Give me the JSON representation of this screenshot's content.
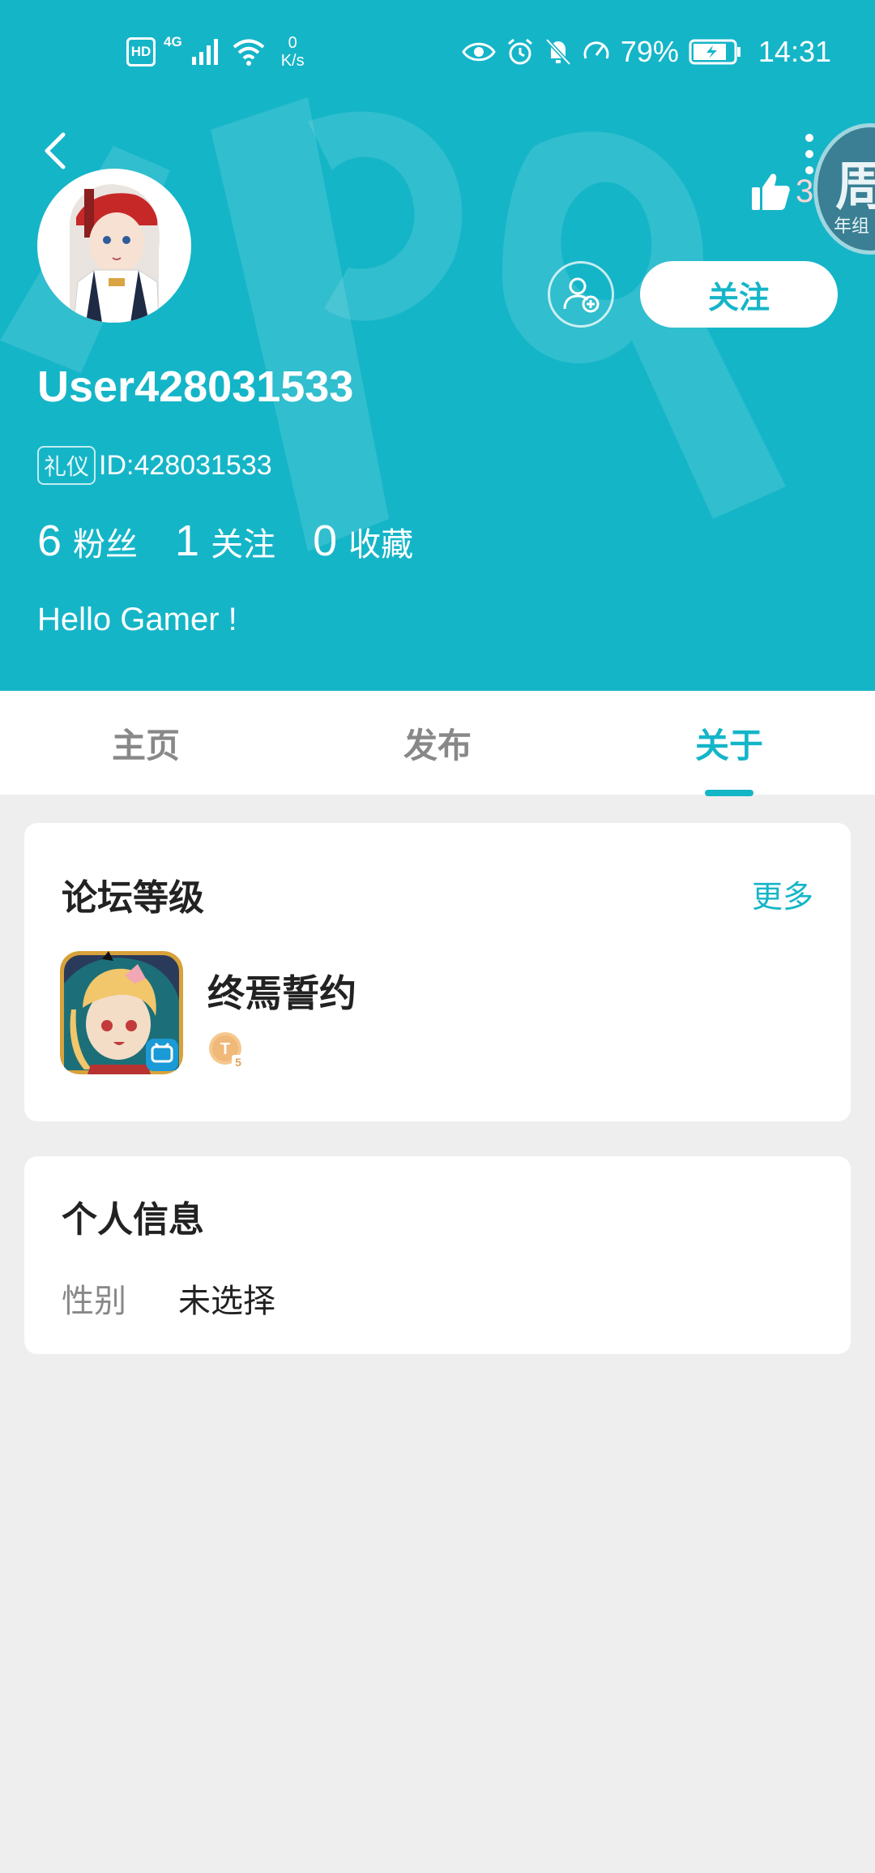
{
  "status_bar": {
    "hd": "HD",
    "network": "4G",
    "speed_value": "0",
    "speed_unit": "K/s",
    "battery": "79%",
    "time": "14:31"
  },
  "header": {
    "background_color": "#15b5c8",
    "like_count": "35",
    "float_badge_text": "周",
    "float_badge_sub": "年组",
    "follow_label": "关注",
    "username": "User428031533",
    "id_tag": "礼仪",
    "id_text": "ID:428031533",
    "stats": [
      {
        "num": "6",
        "label": "粉丝"
      },
      {
        "num": "1",
        "label": "关注"
      },
      {
        "num": "0",
        "label": "收藏"
      }
    ],
    "bio": "Hello Gamer !"
  },
  "tabs": [
    {
      "label": "主页",
      "active": false
    },
    {
      "label": "发布",
      "active": false
    },
    {
      "label": "关于",
      "active": true
    }
  ],
  "forum_level": {
    "title": "论坛等级",
    "more": "更多",
    "game_name": "终焉誓约",
    "level_badge": "T5"
  },
  "personal_info": {
    "title": "个人信息",
    "gender_label": "性别",
    "gender_value": "未选择"
  }
}
